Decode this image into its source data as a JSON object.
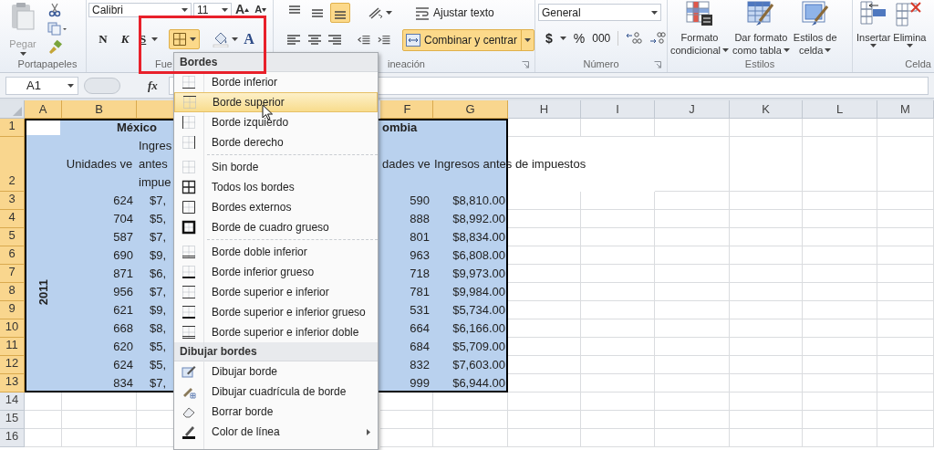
{
  "clipboard": {
    "paste": "Pegar",
    "label": "Portapapeles"
  },
  "font": {
    "name": "Calibri",
    "size": "11",
    "grow": "A",
    "shrink": "A",
    "bold": "N",
    "italic": "K",
    "underline": "S",
    "font_color": "A",
    "borders_selected": true,
    "label": "Fue"
  },
  "alignment": {
    "vertical": [
      {
        "kind": "top",
        "selected": false
      },
      {
        "kind": "middle",
        "selected": false
      },
      {
        "kind": "bottom",
        "selected": true
      }
    ],
    "horizontal": [
      {
        "kind": "left",
        "selected": false
      },
      {
        "kind": "center",
        "selected": false
      },
      {
        "kind": "right",
        "selected": false
      }
    ],
    "wrap_text": "Ajustar texto",
    "merge": {
      "label": "Combinar y centrar",
      "selected": true
    },
    "label": "ineación"
  },
  "number": {
    "format": "General",
    "currency": "$",
    "percent": "%",
    "thousands": "000",
    "label": "Número"
  },
  "styles": {
    "buttons": [
      {
        "kind": "conditional",
        "lines": [
          "Formato",
          "condicional"
        ]
      },
      {
        "kind": "table",
        "lines": [
          "Dar formato",
          "como tabla"
        ]
      },
      {
        "kind": "cell_styles",
        "lines": [
          "Estilos de",
          "celda"
        ]
      }
    ],
    "label": "Estilos"
  },
  "cells": {
    "buttons": [
      {
        "kind": "insert",
        "label": "Insertar"
      },
      {
        "kind": "delete",
        "label": "Elimina"
      }
    ],
    "label": "Celda"
  },
  "formula_bar": {
    "name_box": "A1",
    "fx": "fx"
  },
  "sheet": {
    "columns_left": [
      {
        "label": "A",
        "selected": true
      },
      {
        "label": "B",
        "selected": true
      }
    ],
    "columns_right": [
      {
        "label": "F",
        "selected": true
      },
      {
        "label": "G",
        "selected": true
      },
      {
        "label": "H",
        "selected": false
      },
      {
        "label": "I",
        "selected": false
      },
      {
        "label": "J",
        "selected": false
      },
      {
        "label": "K",
        "selected": false
      },
      {
        "label": "L",
        "selected": false
      },
      {
        "label": "M",
        "selected": false
      }
    ],
    "row_headers": [
      {
        "label": "1",
        "selected": true
      },
      {
        "label": "2",
        "selected": true
      },
      {
        "label": "3",
        "selected": true
      },
      {
        "label": "4",
        "selected": true
      },
      {
        "label": "5",
        "selected": true
      },
      {
        "label": "6",
        "selected": true
      },
      {
        "label": "7",
        "selected": true
      },
      {
        "label": "8",
        "selected": true
      },
      {
        "label": "9",
        "selected": true
      },
      {
        "label": "10",
        "selected": true
      },
      {
        "label": "11",
        "selected": true
      },
      {
        "label": "12",
        "selected": true
      },
      {
        "label": "13",
        "selected": true
      },
      {
        "label": "14",
        "selected": false
      },
      {
        "label": "15",
        "selected": false
      },
      {
        "label": "16",
        "selected": false
      }
    ],
    "title_row": {
      "b": "México",
      "f": "ombia"
    },
    "header_row": {
      "b": "Unidades ve",
      "c": [
        "Ingres",
        "antes",
        "impue"
      ],
      "f": "dades ve",
      "g": "Ingresos antes de impuestos"
    },
    "year": "2011",
    "data": [
      {
        "b": "624",
        "c": "$7,",
        "f": "590",
        "g": "$8,810.00"
      },
      {
        "b": "704",
        "c": "$5,",
        "f": "888",
        "g": "$8,992.00"
      },
      {
        "b": "587",
        "c": "$7,",
        "f": "801",
        "g": "$8,834.00"
      },
      {
        "b": "690",
        "c": "$9,",
        "f": "963",
        "g": "$6,808.00"
      },
      {
        "b": "871",
        "c": "$6,",
        "f": "718",
        "g": "$9,973.00"
      },
      {
        "b": "956",
        "c": "$7,",
        "f": "781",
        "g": "$9,984.00"
      },
      {
        "b": "621",
        "c": "$9,",
        "f": "531",
        "g": "$5,734.00"
      },
      {
        "b": "668",
        "c": "$8,",
        "f": "664",
        "g": "$6,166.00"
      },
      {
        "b": "620",
        "c": "$5,",
        "f": "684",
        "g": "$5,709.00"
      },
      {
        "b": "624",
        "c": "$5,",
        "f": "832",
        "g": "$7,603.00"
      },
      {
        "b": "834",
        "c": "$7,",
        "f": "999",
        "g": "$6,944.00"
      }
    ]
  },
  "menu": {
    "sections": [
      {
        "header": "Bordes",
        "groups": [
          [
            {
              "label": "Borde inferior",
              "kind": "bottom",
              "selected": false
            },
            {
              "label": "Borde superior",
              "kind": "top",
              "selected": true
            },
            {
              "label": "Borde izquierdo",
              "kind": "left",
              "selected": false
            },
            {
              "label": "Borde derecho",
              "kind": "right",
              "selected": false
            }
          ],
          [
            {
              "label": "Sin borde",
              "kind": "none",
              "selected": false
            },
            {
              "label": "Todos los bordes",
              "kind": "all",
              "selected": false
            },
            {
              "label": "Bordes externos",
              "kind": "outside",
              "selected": false
            },
            {
              "label": "Borde de cuadro grueso",
              "kind": "thick_box",
              "selected": false
            }
          ],
          [
            {
              "label": "Borde doble inferior",
              "kind": "double_bottom",
              "selected": false
            },
            {
              "label": "Borde inferior grueso",
              "kind": "thick_bottom",
              "selected": false
            },
            {
              "label": "Borde superior e inferior",
              "kind": "top_bottom",
              "selected": false
            },
            {
              "label": "Borde superior e inferior grueso",
              "kind": "top_thick_bottom",
              "selected": false
            },
            {
              "label": "Borde superior e inferior doble",
              "kind": "top_double_bottom",
              "selected": false
            }
          ]
        ]
      },
      {
        "header": "Dibujar bordes",
        "groups": [
          [
            {
              "label": "Dibujar borde",
              "kind": "draw",
              "selected": false
            },
            {
              "label": "Dibujar cuadrícula de borde",
              "kind": "draw_grid",
              "selected": false
            },
            {
              "label": "Borrar borde",
              "kind": "erase",
              "selected": false
            },
            {
              "label": "Color de línea",
              "kind": "line_color",
              "selected": false,
              "submenu": true
            }
          ]
        ]
      }
    ]
  }
}
